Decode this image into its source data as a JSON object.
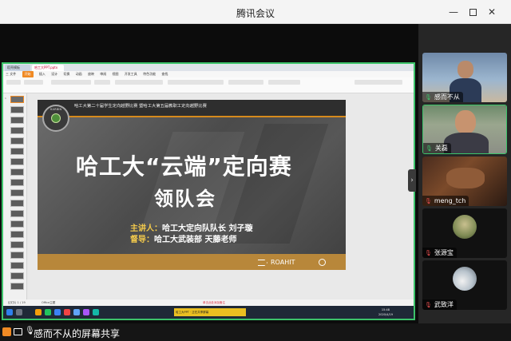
{
  "window": {
    "title": "腾讯会议",
    "minimize_label": "—",
    "close_label": "✕"
  },
  "shared_app": {
    "tabs": [
      "稻壳模板",
      "哈工大PPT.pptx"
    ],
    "menu": [
      "三 文件",
      "开始",
      "插入",
      "设计",
      "切换",
      "动画",
      "放映",
      "审阅",
      "视图",
      "开发工具",
      "特色功能",
      "查找"
    ],
    "menu_active": "开始",
    "status_left": "幻灯片 1 / 19",
    "status_mid": "Office主题",
    "status_right": "单击此处添加备注",
    "taskbar_center": "哈工大PPT · 正在共享屏幕",
    "taskbar_time": "15:48",
    "taskbar_date": "2020/4/19"
  },
  "slide": {
    "header_line1": "哈工大第二十届学生定向越野比赛 暨哈工大第五届教职工定向越野比赛",
    "header_line2": "",
    "logo_text": "HARBIN",
    "title": "哈工大“云端”定向赛",
    "subtitle": "领队会",
    "speaker_key": "主讲人：",
    "speaker_val": "哈工大定向队队长 刘子璇",
    "guide_key": "督导：",
    "guide_val": "哈工大武装部 天藤老师",
    "brand": "ROAHIT"
  },
  "participants": [
    {
      "name": "感而不从",
      "mic": "on",
      "avatar": "photo"
    },
    {
      "name": "关磊",
      "mic": "on",
      "avatar": "camera",
      "speaking": true
    },
    {
      "name": "meng_tch",
      "mic": "off",
      "avatar": "dark"
    },
    {
      "name": "张源宝",
      "mic": "off",
      "avatar": "round1"
    },
    {
      "name": "武致洋",
      "mic": "off",
      "avatar": "round2"
    }
  ],
  "share_bar": {
    "text": "感而不从的屏幕共享"
  },
  "colors": {
    "speaking_border": "#3cc36a",
    "accent_orange": "#f08a24",
    "mic_muted": "#e04d4d"
  }
}
